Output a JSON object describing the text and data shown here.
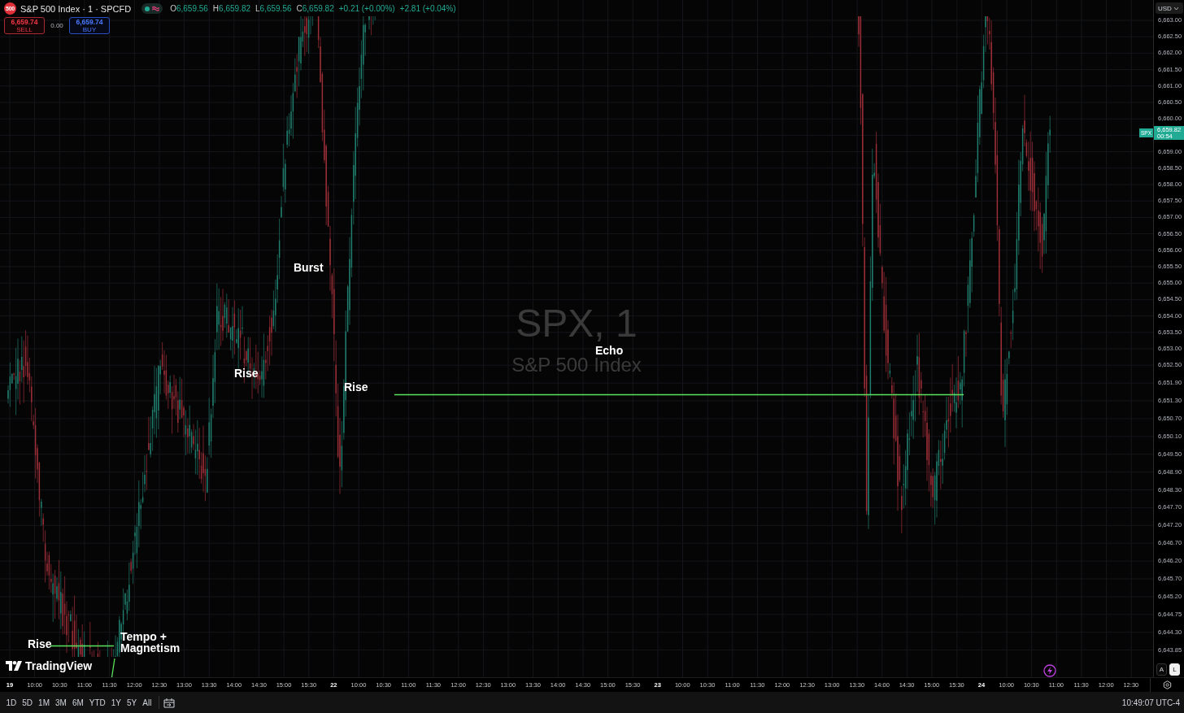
{
  "header": {
    "symbol_badge": "500",
    "title": "S&P 500 Index · 1 · SPCFD",
    "ohlc": [
      {
        "label": "O",
        "value": "6,659.56"
      },
      {
        "label": "H",
        "value": "6,659.82"
      },
      {
        "label": "L",
        "value": "6,659.56"
      },
      {
        "label": "C",
        "value": "6,659.82"
      }
    ],
    "changes": [
      "+0.21 (+0.00%)",
      "+2.81 (+0.04%)"
    ]
  },
  "trade": {
    "sell": {
      "price": "6,659.74",
      "label": "SELL"
    },
    "spread": "0.00",
    "buy": {
      "price": "6,659.74",
      "label": "BUY"
    }
  },
  "watermark": {
    "symbol": "SPX, 1",
    "name": "S&P 500 Index"
  },
  "annotations": [
    {
      "text": "Burst"
    },
    {
      "text": "Rise"
    },
    {
      "text": "Rise"
    },
    {
      "text": "Echo"
    },
    {
      "text": "Rise"
    },
    {
      "text": "Tempo + Magnetism"
    }
  ],
  "logo": {
    "text": "TradingView"
  },
  "price_axis": {
    "currency": "USD",
    "labels_above": [
      "6,663.00",
      "6,662.50",
      "6,662.00",
      "6,661.50",
      "6,661.00",
      "6,660.50",
      "6,660.00"
    ],
    "last_price": {
      "symbol": "SPX",
      "price": "6,659.82",
      "countdown": "00:54"
    },
    "labels_below": [
      "6,659.00",
      "6,658.50",
      "6,658.00",
      "6,657.50",
      "6,657.00",
      "6,656.50",
      "6,656.00",
      "6,655.50",
      "6,655.00",
      "6,654.50",
      "6,654.00",
      "6,653.50",
      "6,653.00",
      "6,652.50",
      "6,651.90",
      "6,651.30",
      "6,650.70",
      "6,650.10",
      "6,649.50",
      "6,648.90",
      "6,648.30",
      "6,647.70",
      "6,647.20",
      "6,646.70",
      "6,646.20",
      "6,645.70",
      "6,645.20",
      "6,644.75",
      "6,644.30",
      "6,643.85"
    ],
    "scale_modes": [
      {
        "label": "A",
        "selected": false
      },
      {
        "label": "L",
        "selected": true
      }
    ]
  },
  "time_axis": {
    "labels": [
      {
        "text": "19",
        "kind": "date"
      },
      {
        "text": "10:00",
        "kind": "time"
      },
      {
        "text": "10:30",
        "kind": "time"
      },
      {
        "text": "11:00",
        "kind": "time"
      },
      {
        "text": "11:30",
        "kind": "time"
      },
      {
        "text": "12:00",
        "kind": "time"
      },
      {
        "text": "12:30",
        "kind": "time"
      },
      {
        "text": "13:00",
        "kind": "time"
      },
      {
        "text": "13:30",
        "kind": "time"
      },
      {
        "text": "14:00",
        "kind": "time"
      },
      {
        "text": "14:30",
        "kind": "time"
      },
      {
        "text": "15:00",
        "kind": "time"
      },
      {
        "text": "15:30",
        "kind": "time"
      },
      {
        "text": "22",
        "kind": "date"
      },
      {
        "text": "10:00",
        "kind": "time"
      },
      {
        "text": "10:30",
        "kind": "time"
      },
      {
        "text": "11:00",
        "kind": "time"
      },
      {
        "text": "11:30",
        "kind": "time"
      },
      {
        "text": "12:00",
        "kind": "time"
      },
      {
        "text": "12:30",
        "kind": "time"
      },
      {
        "text": "13:00",
        "kind": "time"
      },
      {
        "text": "13:30",
        "kind": "time"
      },
      {
        "text": "14:00",
        "kind": "time"
      },
      {
        "text": "14:30",
        "kind": "time"
      },
      {
        "text": "15:00",
        "kind": "time"
      },
      {
        "text": "15:30",
        "kind": "time"
      },
      {
        "text": "23",
        "kind": "date"
      },
      {
        "text": "10:00",
        "kind": "time"
      },
      {
        "text": "10:30",
        "kind": "time"
      },
      {
        "text": "11:00",
        "kind": "time"
      },
      {
        "text": "11:30",
        "kind": "time"
      },
      {
        "text": "12:00",
        "kind": "time"
      },
      {
        "text": "12:30",
        "kind": "time"
      },
      {
        "text": "13:00",
        "kind": "time"
      },
      {
        "text": "13:30",
        "kind": "time"
      },
      {
        "text": "14:00",
        "kind": "time"
      },
      {
        "text": "14:30",
        "kind": "time"
      },
      {
        "text": "15:00",
        "kind": "time"
      },
      {
        "text": "15:30",
        "kind": "time"
      },
      {
        "text": "24",
        "kind": "date"
      },
      {
        "text": "10:00",
        "kind": "time"
      },
      {
        "text": "10:30",
        "kind": "time"
      },
      {
        "text": "11:00",
        "kind": "time"
      },
      {
        "text": "11:30",
        "kind": "time"
      },
      {
        "text": "12:00",
        "kind": "time"
      },
      {
        "text": "12:30",
        "kind": "time"
      }
    ]
  },
  "toolbar": {
    "ranges": [
      "1D",
      "5D",
      "1M",
      "3M",
      "6M",
      "YTD",
      "1Y",
      "5Y",
      "All"
    ],
    "clock": "10:49:07 UTC-4"
  }
}
